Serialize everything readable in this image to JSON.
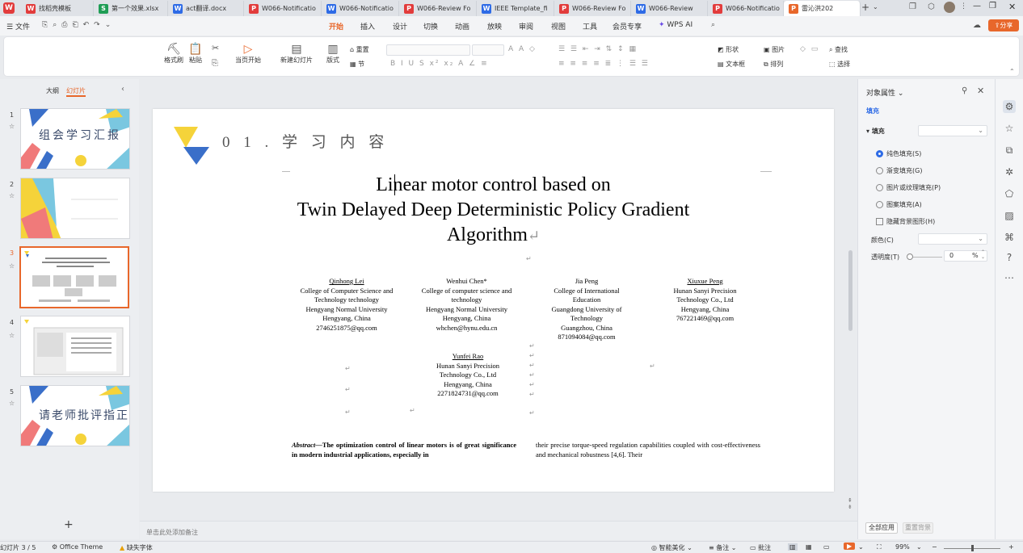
{
  "tabs": [
    {
      "icon": "W",
      "label": "找稻壳模板",
      "color": "#e23c3c"
    },
    {
      "icon": "S",
      "label": "第一个效果.xlsx",
      "color": "#1f9d55"
    },
    {
      "icon": "W",
      "label": "act翻译.docx",
      "color": "#2e6be6"
    },
    {
      "icon": "P",
      "label": "W066-Notificatio",
      "color": "#e23c3c"
    },
    {
      "icon": "W",
      "label": "W066-Notificatio",
      "color": "#2e6be6"
    },
    {
      "icon": "P",
      "label": "W066-Review Fo",
      "color": "#e23c3c"
    },
    {
      "icon": "W",
      "label": "IEEE Template_fi",
      "color": "#2e6be6"
    },
    {
      "icon": "P",
      "label": "W066-Review Fo",
      "color": "#e23c3c"
    },
    {
      "icon": "W",
      "label": "W066-Review",
      "color": "#2e6be6"
    },
    {
      "icon": "P",
      "label": "W066-Notificatio",
      "color": "#e23c3c"
    },
    {
      "icon": "P",
      "label": "雷沁洪202",
      "color": "#e8672b"
    }
  ],
  "share_label": "分享",
  "menu": {
    "file": "文件",
    "items": [
      "开始",
      "插入",
      "设计",
      "切换",
      "动画",
      "放映",
      "审阅",
      "视图",
      "工具",
      "会员专享",
      "WPS AI"
    ]
  },
  "ribbon": {
    "format_painter": "格式刷",
    "paste": "粘贴",
    "play_from_current": "当页开始",
    "new_slide": "新建幻灯片",
    "layout": "版式",
    "reset": "重置",
    "section": "节",
    "shape": "形状",
    "picture": "图片",
    "textbox": "文本框",
    "arrange": "排列",
    "find": "查找",
    "select": "选择"
  },
  "left_panel": {
    "outline_tab": "大纲",
    "slides_tab": "幻灯片",
    "thumbs": [
      {
        "num": "1",
        "title": "组会学习汇报"
      },
      {
        "num": "2",
        "title": ""
      },
      {
        "num": "3",
        "title": ""
      },
      {
        "num": "4",
        "title": ""
      },
      {
        "num": "5",
        "title": "请老师批评指正"
      }
    ],
    "notes_placeholder": "单击此处添加备注"
  },
  "slide": {
    "section_heading": "0 1 . 学 习 内 容",
    "title_line1": "Linear motor control based on",
    "title_line2": "Twin Delayed Deep Deterministic Policy Gradient",
    "title_line3": "Algorithm",
    "authors": [
      {
        "name": "Qinhong Lei",
        "lines": [
          "College of Computer Science and",
          "Technology technology",
          "Hengyang Normal University",
          "Hengyang, China",
          "2746251875@qq.com"
        ]
      },
      {
        "name": "Wenhui Chen*",
        "lines": [
          "College of computer science and",
          "technology",
          "Hengyang Normal University",
          "Hengyang, China",
          "whchen@hynu.edu.cn"
        ]
      },
      {
        "name": "Jia Peng",
        "lines": [
          "College of International",
          "Education",
          "Guangdong University of",
          "Technology",
          "Guangzhou, China",
          "871094084@qq.com"
        ]
      },
      {
        "name": "Xiuxue Peng",
        "lines": [
          "Hunan Sanyi Precision",
          "Technology Co., Ltd",
          "Hengyang, China",
          "767221469@qq.com"
        ]
      },
      {
        "name": "Yunfei Rao",
        "lines": [
          "Hunan Sanyi Precision",
          "Technology Co., Ltd",
          "Hengyang, China",
          "2271824731@qq.com"
        ]
      }
    ],
    "abstract_label": "Abstract",
    "abstract_left": "—The optimization control of linear motors is of great significance in modern industrial applications, especially in",
    "abstract_right": "their precise torque-speed regulation capabilities coupled with cost-effectiveness and mechanical robustness [4,6]. Their"
  },
  "right_panel": {
    "title": "对象属性",
    "fill_tab": "填充",
    "fill_label": "填充",
    "options": [
      "纯色填充(S)",
      "渐变填充(G)",
      "图片或纹理填充(P)",
      "图案填充(A)"
    ],
    "hide_bg": "隐藏背景图形(H)",
    "color_label": "颜色(C)",
    "transparency_label": "透明度(T)",
    "transparency_value": "0",
    "transparency_unit": "%",
    "apply_all": "全部应用",
    "reset_bg": "重置背景"
  },
  "status": {
    "slide_pos": "幻灯片 3 / 5",
    "theme": "Office Theme",
    "missing_font": "缺失字体",
    "smart_beautify": "智能美化",
    "notes": "备注",
    "comment": "批注",
    "zoom": "99%"
  }
}
